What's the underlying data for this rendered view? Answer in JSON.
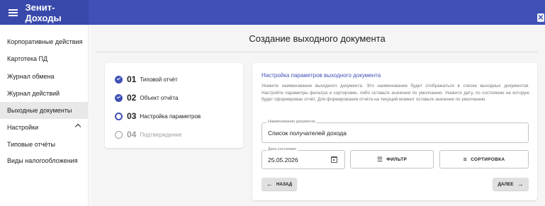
{
  "app": {
    "title": "Зенит-Доходы"
  },
  "sidebar": {
    "items": [
      {
        "label": "Корпоративные действия"
      },
      {
        "label": "Картотека ПД"
      },
      {
        "label": "Журнал обмена"
      },
      {
        "label": "Журнал действий"
      },
      {
        "label": "Выходные документы",
        "active": true
      },
      {
        "label": "Настройки",
        "expandable": true
      },
      {
        "label": "Типовые отчёты"
      },
      {
        "label": "Виды налогообложения"
      }
    ]
  },
  "page": {
    "title": "Создание выходного документа"
  },
  "stepper": {
    "steps": [
      {
        "number": "01",
        "label": "Типовой отчёт",
        "state": "done"
      },
      {
        "number": "02",
        "label": "Объект отчёта",
        "state": "done"
      },
      {
        "number": "03",
        "label": "Настройка параметров",
        "state": "current"
      },
      {
        "number": "04",
        "label": "Подтверждение",
        "state": "pending"
      }
    ]
  },
  "settings": {
    "title": "Настройка параметров выходного документа",
    "description": "Укажите наименование выходного документа. Это наименование будет отображаться в списке выходных документов. Настройте параметры фильтра и сортировки, либо оставьте значения по умолчанию. Укажите дату, по состоянию на которую будет сформирован отчёт. Для формирования отчёта на текущий момент оставьте значение по умолчанию.",
    "doc_name": {
      "label": "Наименование документа",
      "value": "Список получателей дохода"
    },
    "date": {
      "label": "Дата состояния",
      "value": "25.05.2026"
    },
    "filter_label": "ФИЛЬТР",
    "sort_label": "СОРТИРОВКА",
    "back_label": "НАЗАД",
    "next_label": "ДАЛЕЕ"
  },
  "icons": {
    "menu": "menu-icon",
    "close": "close-icon",
    "calendar": "calendar-icon",
    "filter": "filter-icon",
    "sort": "sort-icon",
    "back": "arrow-left-icon",
    "next": "arrow-right-icon"
  },
  "colors": {
    "primary": "#3f51b5",
    "header_dark": "#3949ab",
    "active_item": "#e8e8e8"
  }
}
